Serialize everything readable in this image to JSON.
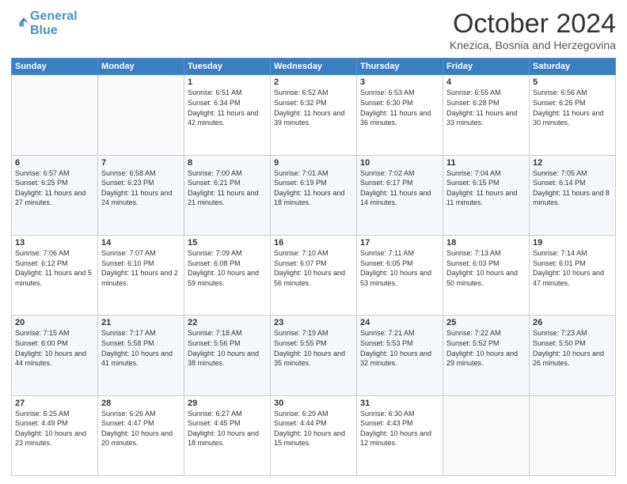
{
  "logo": {
    "text1": "General",
    "text2": "Blue"
  },
  "header": {
    "month": "October 2024",
    "location": "Knezica, Bosnia and Herzegovina"
  },
  "weekdays": [
    "Sunday",
    "Monday",
    "Tuesday",
    "Wednesday",
    "Thursday",
    "Friday",
    "Saturday"
  ],
  "weeks": [
    [
      {
        "day": "",
        "sunrise": "",
        "sunset": "",
        "daylight": ""
      },
      {
        "day": "",
        "sunrise": "",
        "sunset": "",
        "daylight": ""
      },
      {
        "day": "1",
        "sunrise": "Sunrise: 6:51 AM",
        "sunset": "Sunset: 6:34 PM",
        "daylight": "Daylight: 11 hours and 42 minutes."
      },
      {
        "day": "2",
        "sunrise": "Sunrise: 6:52 AM",
        "sunset": "Sunset: 6:32 PM",
        "daylight": "Daylight: 11 hours and 39 minutes."
      },
      {
        "day": "3",
        "sunrise": "Sunrise: 6:53 AM",
        "sunset": "Sunset: 6:30 PM",
        "daylight": "Daylight: 11 hours and 36 minutes."
      },
      {
        "day": "4",
        "sunrise": "Sunrise: 6:55 AM",
        "sunset": "Sunset: 6:28 PM",
        "daylight": "Daylight: 11 hours and 33 minutes."
      },
      {
        "day": "5",
        "sunrise": "Sunrise: 6:56 AM",
        "sunset": "Sunset: 6:26 PM",
        "daylight": "Daylight: 11 hours and 30 minutes."
      }
    ],
    [
      {
        "day": "6",
        "sunrise": "Sunrise: 6:57 AM",
        "sunset": "Sunset: 6:25 PM",
        "daylight": "Daylight: 11 hours and 27 minutes."
      },
      {
        "day": "7",
        "sunrise": "Sunrise: 6:58 AM",
        "sunset": "Sunset: 6:23 PM",
        "daylight": "Daylight: 11 hours and 24 minutes."
      },
      {
        "day": "8",
        "sunrise": "Sunrise: 7:00 AM",
        "sunset": "Sunset: 6:21 PM",
        "daylight": "Daylight: 11 hours and 21 minutes."
      },
      {
        "day": "9",
        "sunrise": "Sunrise: 7:01 AM",
        "sunset": "Sunset: 6:19 PM",
        "daylight": "Daylight: 11 hours and 18 minutes."
      },
      {
        "day": "10",
        "sunrise": "Sunrise: 7:02 AM",
        "sunset": "Sunset: 6:17 PM",
        "daylight": "Daylight: 11 hours and 14 minutes."
      },
      {
        "day": "11",
        "sunrise": "Sunrise: 7:04 AM",
        "sunset": "Sunset: 6:15 PM",
        "daylight": "Daylight: 11 hours and 11 minutes."
      },
      {
        "day": "12",
        "sunrise": "Sunrise: 7:05 AM",
        "sunset": "Sunset: 6:14 PM",
        "daylight": "Daylight: 11 hours and 8 minutes."
      }
    ],
    [
      {
        "day": "13",
        "sunrise": "Sunrise: 7:06 AM",
        "sunset": "Sunset: 6:12 PM",
        "daylight": "Daylight: 11 hours and 5 minutes."
      },
      {
        "day": "14",
        "sunrise": "Sunrise: 7:07 AM",
        "sunset": "Sunset: 6:10 PM",
        "daylight": "Daylight: 11 hours and 2 minutes."
      },
      {
        "day": "15",
        "sunrise": "Sunrise: 7:09 AM",
        "sunset": "Sunset: 6:08 PM",
        "daylight": "Daylight: 10 hours and 59 minutes."
      },
      {
        "day": "16",
        "sunrise": "Sunrise: 7:10 AM",
        "sunset": "Sunset: 6:07 PM",
        "daylight": "Daylight: 10 hours and 56 minutes."
      },
      {
        "day": "17",
        "sunrise": "Sunrise: 7:11 AM",
        "sunset": "Sunset: 6:05 PM",
        "daylight": "Daylight: 10 hours and 53 minutes."
      },
      {
        "day": "18",
        "sunrise": "Sunrise: 7:13 AM",
        "sunset": "Sunset: 6:03 PM",
        "daylight": "Daylight: 10 hours and 50 minutes."
      },
      {
        "day": "19",
        "sunrise": "Sunrise: 7:14 AM",
        "sunset": "Sunset: 6:01 PM",
        "daylight": "Daylight: 10 hours and 47 minutes."
      }
    ],
    [
      {
        "day": "20",
        "sunrise": "Sunrise: 7:15 AM",
        "sunset": "Sunset: 6:00 PM",
        "daylight": "Daylight: 10 hours and 44 minutes."
      },
      {
        "day": "21",
        "sunrise": "Sunrise: 7:17 AM",
        "sunset": "Sunset: 5:58 PM",
        "daylight": "Daylight: 10 hours and 41 minutes."
      },
      {
        "day": "22",
        "sunrise": "Sunrise: 7:18 AM",
        "sunset": "Sunset: 5:56 PM",
        "daylight": "Daylight: 10 hours and 38 minutes."
      },
      {
        "day": "23",
        "sunrise": "Sunrise: 7:19 AM",
        "sunset": "Sunset: 5:55 PM",
        "daylight": "Daylight: 10 hours and 35 minutes."
      },
      {
        "day": "24",
        "sunrise": "Sunrise: 7:21 AM",
        "sunset": "Sunset: 5:53 PM",
        "daylight": "Daylight: 10 hours and 32 minutes."
      },
      {
        "day": "25",
        "sunrise": "Sunrise: 7:22 AM",
        "sunset": "Sunset: 5:52 PM",
        "daylight": "Daylight: 10 hours and 29 minutes."
      },
      {
        "day": "26",
        "sunrise": "Sunrise: 7:23 AM",
        "sunset": "Sunset: 5:50 PM",
        "daylight": "Daylight: 10 hours and 26 minutes."
      }
    ],
    [
      {
        "day": "27",
        "sunrise": "Sunrise: 6:25 AM",
        "sunset": "Sunset: 4:49 PM",
        "daylight": "Daylight: 10 hours and 23 minutes."
      },
      {
        "day": "28",
        "sunrise": "Sunrise: 6:26 AM",
        "sunset": "Sunset: 4:47 PM",
        "daylight": "Daylight: 10 hours and 20 minutes."
      },
      {
        "day": "29",
        "sunrise": "Sunrise: 6:27 AM",
        "sunset": "Sunset: 4:45 PM",
        "daylight": "Daylight: 10 hours and 18 minutes."
      },
      {
        "day": "30",
        "sunrise": "Sunrise: 6:29 AM",
        "sunset": "Sunset: 4:44 PM",
        "daylight": "Daylight: 10 hours and 15 minutes."
      },
      {
        "day": "31",
        "sunrise": "Sunrise: 6:30 AM",
        "sunset": "Sunset: 4:43 PM",
        "daylight": "Daylight: 10 hours and 12 minutes."
      },
      {
        "day": "",
        "sunrise": "",
        "sunset": "",
        "daylight": ""
      },
      {
        "day": "",
        "sunrise": "",
        "sunset": "",
        "daylight": ""
      }
    ]
  ]
}
